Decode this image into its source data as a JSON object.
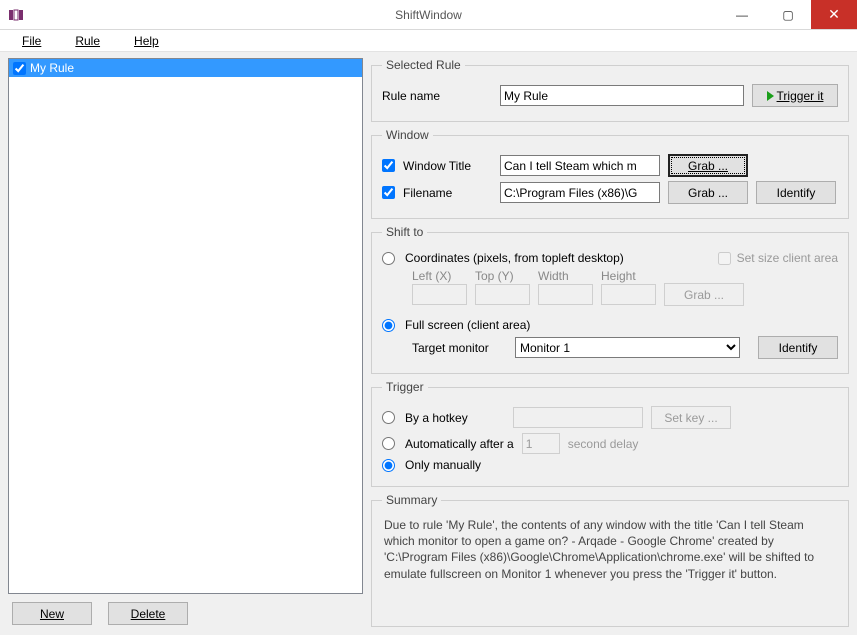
{
  "window": {
    "title": "ShiftWindow",
    "min": "—",
    "max": "▢",
    "close": "✕"
  },
  "menu": {
    "file": "File",
    "rule": "Rule",
    "help": "Help"
  },
  "left": {
    "items": [
      {
        "label": "My Rule",
        "checked": true
      }
    ],
    "new_btn": "New",
    "delete_btn": "Delete"
  },
  "selected_rule": {
    "legend": "Selected Rule",
    "name_label": "Rule name",
    "name_value": "My Rule",
    "trigger_btn": "Trigger it"
  },
  "window_section": {
    "legend": "Window",
    "title_label": "Window Title",
    "title_value": "Can I tell Steam which m",
    "grab_btn": "Grab ...",
    "filename_label": "Filename",
    "filename_value": "C:\\Program Files (x86)\\G",
    "grab2_btn": "Grab ...",
    "identify_btn": "Identify"
  },
  "shift": {
    "legend": "Shift to",
    "coords_label": "Coordinates (pixels, from topleft desktop)",
    "set_client_label": "Set size client area",
    "cols": {
      "left": "Left (X)",
      "top": "Top (Y)",
      "width": "Width",
      "height": "Height"
    },
    "grab_btn": "Grab ...",
    "fullscreen_label": "Full screen (client area)",
    "target_label": "Target monitor",
    "target_value": "Monitor 1",
    "identify_btn": "Identify"
  },
  "trigger": {
    "legend": "Trigger",
    "hotkey_label": "By a hotkey",
    "setkey_btn": "Set key ...",
    "auto_label_a": "Automatically after a",
    "auto_value": "1",
    "auto_label_b": "second delay",
    "manual_label": "Only manually"
  },
  "summary": {
    "legend": "Summary",
    "text": "Due to rule 'My Rule', the contents of any window with the title 'Can I tell Steam which monitor to open a game on? - Arqade - Google Chrome' created by 'C:\\Program Files (x86)\\Google\\Chrome\\Application\\chrome.exe' will be shifted to emulate fullscreen on Monitor 1 whenever you press the 'Trigger it' button."
  }
}
